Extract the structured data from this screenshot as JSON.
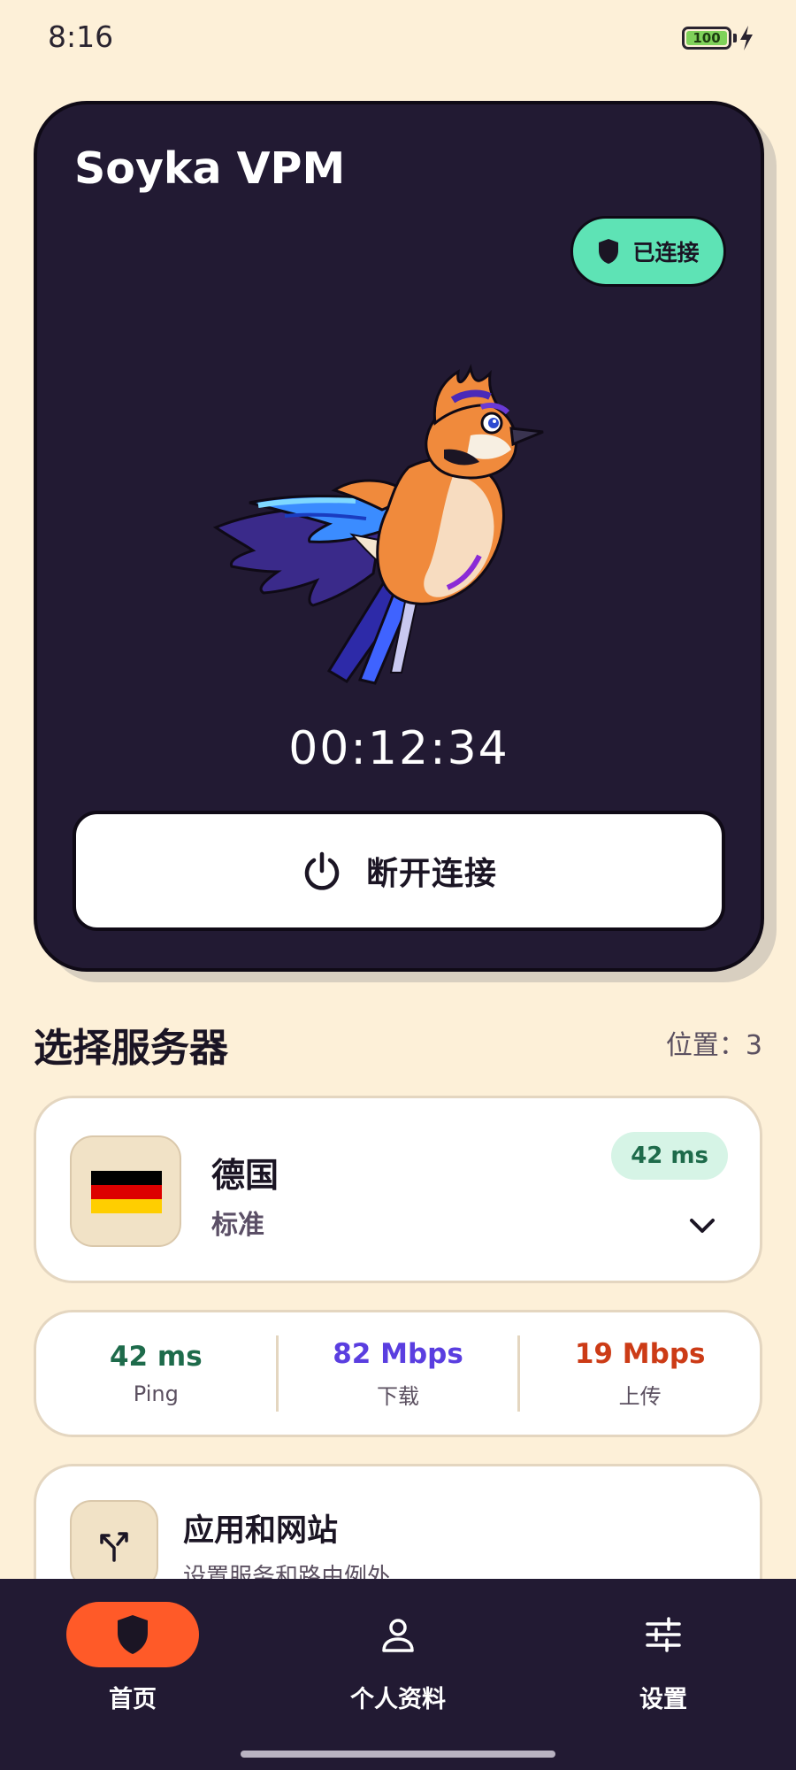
{
  "status_bar": {
    "time": "8:16",
    "battery": "100"
  },
  "hero": {
    "app_title": "Soyka VPM",
    "connection_status": "已连接",
    "timer": "00:12:34",
    "disconnect_label": "断开连接"
  },
  "servers": {
    "section_title": "选择服务器",
    "location_count": "位置：3",
    "selected": {
      "country": "德国",
      "tier": "标准",
      "ping": "42 ms",
      "flag_colors": [
        "#000000",
        "#dd0000",
        "#ffce00"
      ]
    }
  },
  "stats": [
    {
      "value": "42 ms",
      "label": "Ping",
      "color": "#1e6b4b"
    },
    {
      "value": "82 Mbps",
      "label": "下载",
      "color": "#5a3ee0"
    },
    {
      "value": "19 Mbps",
      "label": "上传",
      "color": "#cc3b16"
    }
  ],
  "split_tunneling": {
    "title": "应用和网站",
    "subtitle": "设置服务和路由例外"
  },
  "nav": {
    "items": [
      {
        "label": "首页",
        "icon": "shield-icon",
        "active": true
      },
      {
        "label": "个人资料",
        "icon": "person-icon",
        "active": false
      },
      {
        "label": "设置",
        "icon": "sliders-icon",
        "active": false
      }
    ]
  },
  "colors": {
    "background": "#fdf0d8",
    "card_dark": "#221a33",
    "accent_orange": "#ff5a28",
    "connected_green": "#5ee3b5"
  }
}
